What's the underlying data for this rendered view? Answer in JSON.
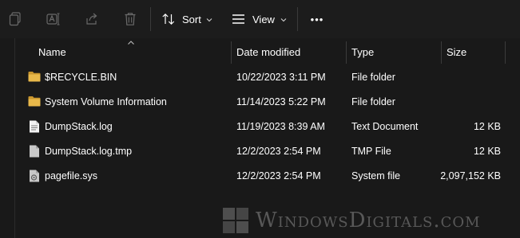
{
  "toolbar": {
    "sort_label": "Sort",
    "view_label": "View",
    "more_label": "•••"
  },
  "columns": {
    "name": "Name",
    "date_modified": "Date modified",
    "type": "Type",
    "size": "Size"
  },
  "files": [
    {
      "name": "$RECYCLE.BIN",
      "date": "10/22/2023 3:11 PM",
      "type": "File folder",
      "size": "",
      "icon": "folder-icon"
    },
    {
      "name": "System Volume Information",
      "date": "11/14/2023 5:22 PM",
      "type": "File folder",
      "size": "",
      "icon": "folder-icon"
    },
    {
      "name": "DumpStack.log",
      "date": "11/19/2023 8:39 AM",
      "type": "Text Document",
      "size": "12 KB",
      "icon": "text-document-icon"
    },
    {
      "name": "DumpStack.log.tmp",
      "date": "12/2/2023 2:54 PM",
      "type": "TMP File",
      "size": "12 KB",
      "icon": "file-icon"
    },
    {
      "name": "pagefile.sys",
      "date": "12/2/2023 2:54 PM",
      "type": "System file",
      "size": "2,097,152 KB",
      "icon": "system-file-icon"
    }
  ],
  "watermark": {
    "text": "WindowsDigitals.com"
  },
  "colors": {
    "background": "#191919",
    "folder": "#d9a93a",
    "text": "#ffffff",
    "separator": "#3b3b3b"
  }
}
